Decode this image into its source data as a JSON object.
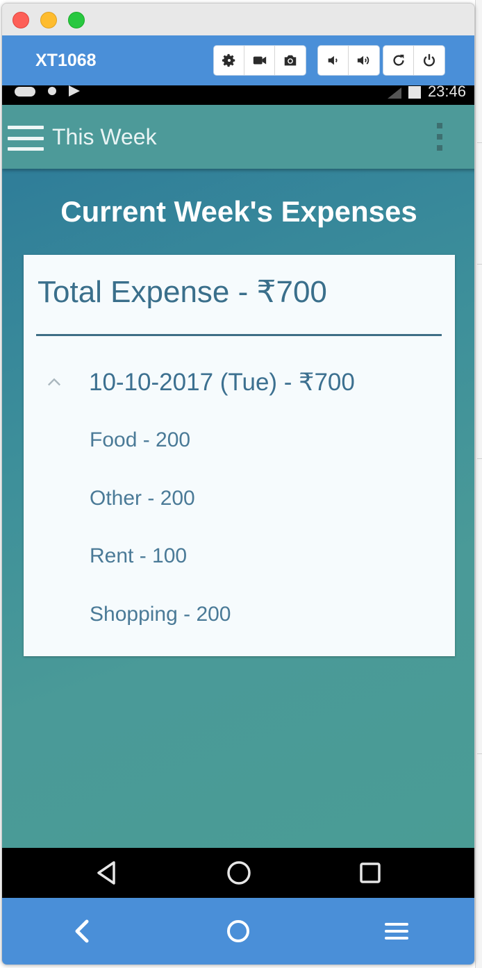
{
  "emulator": {
    "device_name": "XT1068",
    "toolbar_groups": [
      [
        "gear-icon",
        "video-camera-icon",
        "camera-icon"
      ],
      [
        "volume-down-icon",
        "volume-up-icon"
      ],
      [
        "rotate-icon",
        "power-icon"
      ]
    ],
    "footer_buttons": [
      "back-chevron-icon",
      "home-circle-icon",
      "menu-icon"
    ]
  },
  "status_bar": {
    "time": "23:46"
  },
  "app_bar": {
    "title": "This Week"
  },
  "page": {
    "heading": "Current Week's Expenses",
    "total": "Total Expense - ₹700",
    "day": {
      "label": "10-10-2017 (Tue) - ₹700",
      "expanded": true,
      "items": [
        "Food - 200",
        "Other - 200",
        "Rent - 100",
        "Shopping - 200"
      ]
    }
  },
  "android_nav": [
    "back-triangle-icon",
    "home-icon",
    "recents-square-icon"
  ],
  "colors": {
    "emulator_blue": "#4a8fd8",
    "app_bar": "#4d9a99",
    "card_background": "#f6fbfd",
    "text_primary": "#3a6f8b"
  }
}
